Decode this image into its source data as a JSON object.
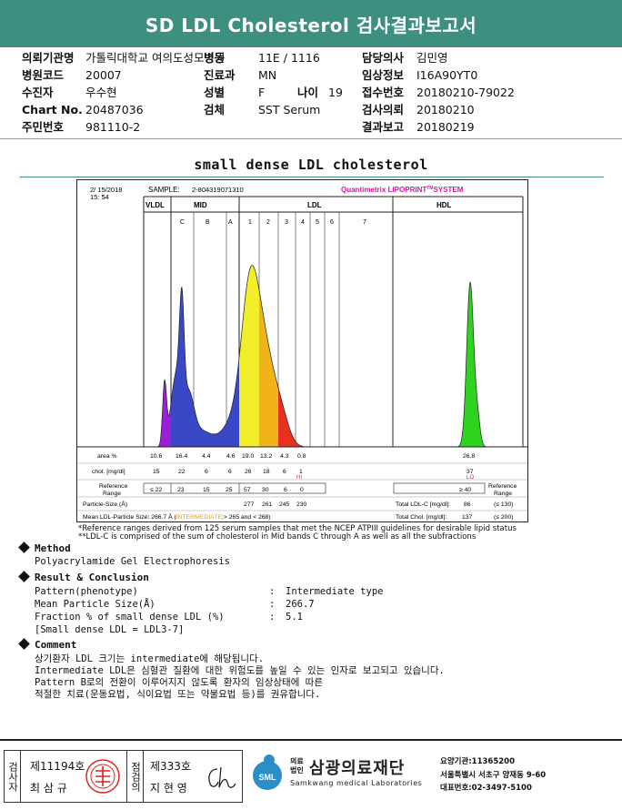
{
  "header": {
    "title": "SD LDL Cholesterol 검사결과보고서"
  },
  "info": {
    "institution_label": "의뢰기관명",
    "institution": "가톨릭대학교 여의도성모병원",
    "ward_label": "병동",
    "ward": "11E / 1116",
    "doctor_label": "담당의사",
    "doctor": "김민영",
    "hospital_code_label": "병원코드",
    "hospital_code": "20007",
    "dept_label": "진료과",
    "dept": "MN",
    "clinical_label": "임상정보",
    "clinical": "I16A90YT0",
    "patient_label": "수진자",
    "patient": "우수현",
    "sex_label": "성별",
    "sex": "F",
    "age_label": "나이",
    "age": "19",
    "receipt_label": "접수번호",
    "receipt": "20180210-79022",
    "chart_label": "Chart No.",
    "chart": "20487036",
    "specimen_label": "검체",
    "specimen": "SST Serum",
    "request_label": "검사의뢰",
    "request": "20180210",
    "id_label": "주민번호",
    "id": "981110-2",
    "report_label": "결과보고",
    "report": "20180219"
  },
  "section_title": "small dense LDL cholesterol",
  "chart_data": {
    "type": "area",
    "date": "2/ 15/2018",
    "time": "15: 54",
    "sample_label": "SAMPLE:",
    "sample": "2-804319071310",
    "brand": "Quantimetrix LIPOPRINT",
    "brand_tm": "TM",
    "brand_suffix": "SYSTEM",
    "groups": [
      "VLDL",
      "MID",
      "LDL",
      "HDL"
    ],
    "bands": [
      "C",
      "B",
      "A",
      "1",
      "2",
      "3",
      "4",
      "5",
      "6",
      "7"
    ],
    "row_area_label": "area %",
    "area": [
      "10.6",
      "16.4",
      "4.4",
      "4.6",
      "19.0",
      "13.2",
      "4.3",
      "0.8",
      "26.8"
    ],
    "row_chol_label": "chol. [mg/dl]",
    "chol": [
      "15",
      "22",
      "6",
      "6",
      "26",
      "18",
      "6",
      "1",
      "37"
    ],
    "flag_hi": "HI",
    "flag_lo": "LO",
    "row_ref_label": [
      "Reference",
      "Range"
    ],
    "ref": [
      "≤ 22",
      "23",
      "15",
      "25",
      "57",
      "30",
      "6",
      "0",
      "≥ 40"
    ],
    "ref_right": [
      "Reference",
      "Range"
    ],
    "particle_size_label": "Particle-Size (Å)",
    "particle_sizes": [
      "277",
      "261",
      "245",
      "230"
    ],
    "mean_label": "Mean LDL-Particle Size:",
    "mean_value": "266.7 Å (",
    "mean_type": "INTERMEDIATE",
    "mean_range": ";> 265 and < 268)",
    "total_ldl_label": "Total LDL-C [mg/dl]:",
    "total_ldl": "86",
    "total_ldl_ref": "(≤ 130)",
    "total_chol_label": "Total Chol. [mg/dl]:",
    "total_chol": "137",
    "total_chol_ref": "(≤ 200)",
    "colors": {
      "vldl": "#9b1fd6",
      "mid": "#3a48c8",
      "ldl1": "#f2ee2a",
      "ldl2": "#f2b21a",
      "ldl3": "#e8321e",
      "hdl": "#2fd21e"
    }
  },
  "footnotes": [
    "*Reference ranges derived from 125 serum samples that met the NCEP ATPIII guidelines for desirable lipid status",
    "**LDL-C is comprised of the sum of cholesterol in Mid bands C through A as well as all the subfractions"
  ],
  "method": {
    "heading": "Method",
    "text": "Polyacrylamide Gel Electrophoresis"
  },
  "result": {
    "heading": "Result & Conclusion",
    "rows": [
      {
        "label": "Pattern(phenotype)",
        "colon": ":",
        "value": "Intermediate type"
      },
      {
        "label": "Mean Particle Size(Å)",
        "colon": ":",
        "value": "266.7"
      },
      {
        "label": "Fraction % of small dense LDL (%)",
        "colon": ":",
        "value": "5.1"
      }
    ],
    "note": "[Small dense LDL = LDL3-7]"
  },
  "comment": {
    "heading": "Comment",
    "lines": [
      "상기환자 LDL 크기는 intermediate에 해당됩니다.",
      "Intermediate LDL은 심혈관 질환에 대한 위험도를 높일 수 있는 인자로 보고되고 있습니다.",
      "Pattern B로의 전환이 이루어지지 않도록 환자의 임상상태에 따른",
      "적절한 치료(운동요법, 식이요법 또는 약물요법 등)를 권유합니다."
    ]
  },
  "footer": {
    "tester_label": "검사자",
    "tester_no": "제11194호",
    "tester_name": "최 삼 규",
    "inspector_label": "점검의",
    "inspector_no": "제333호",
    "inspector_name": "지 현 영",
    "org_small": [
      "의료",
      "법인"
    ],
    "org_name": "삼광의료재단",
    "org_eng": "Samkwang medical Laboratories",
    "logo_text": "SML",
    "addr1": "요양기관:11365200",
    "addr2": "서울특별시 서초구 양재동 9-60",
    "addr3": "대표번호:02-3497-5100"
  }
}
